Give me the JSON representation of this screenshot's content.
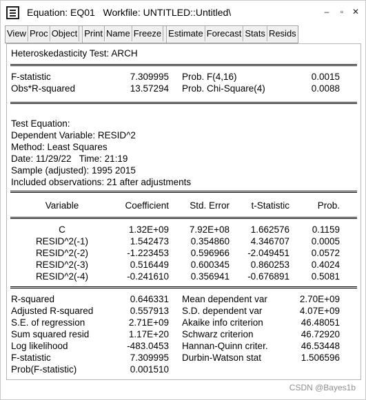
{
  "window": {
    "title": "Equation: EQ01   Workfile: UNTITLED::Untitled\\",
    "controls": [
      "‒",
      "▫",
      "✕"
    ]
  },
  "toolbar": [
    "View",
    "Proc",
    "Object",
    "Print",
    "Name",
    "Freeze",
    "Estimate",
    "Forecast",
    "Stats",
    "Resids"
  ],
  "output": {
    "test_title": "Heteroskedasticity Test: ARCH",
    "summary": [
      {
        "label": "F-statistic",
        "value": "7.309995",
        "prob_label": "Prob. F(4,16)",
        "prob": "0.0015"
      },
      {
        "label": "Obs*R-squared",
        "value": "13.57294",
        "prob_label": "Prob. Chi-Square(4)",
        "prob": "0.0088"
      }
    ],
    "header": [
      "Test Equation:",
      "Dependent Variable: RESID^2",
      "Method: Least Squares",
      "Date: 11/29/22   Time: 21:19",
      "Sample (adjusted): 1995 2015",
      "Included observations: 21 after adjustments"
    ],
    "columns": [
      "Variable",
      "Coefficient",
      "Std. Error",
      "t-Statistic",
      "Prob."
    ],
    "rows": [
      {
        "variable": "C",
        "coef": "1.32E+09",
        "se": "7.92E+08",
        "t": "1.662576",
        "p": "0.1159"
      },
      {
        "variable": "RESID^2(-1)",
        "coef": "1.542473",
        "se": "0.354860",
        "t": "4.346707",
        "p": "0.0005"
      },
      {
        "variable": "RESID^2(-2)",
        "coef": "-1.223453",
        "se": "0.596966",
        "t": "-2.049451",
        "p": "0.0572"
      },
      {
        "variable": "RESID^2(-3)",
        "coef": "0.516449",
        "se": "0.600345",
        "t": "0.860253",
        "p": "0.4024"
      },
      {
        "variable": "RESID^2(-4)",
        "coef": "-0.241610",
        "se": "0.356941",
        "t": "-0.676891",
        "p": "0.5081"
      }
    ],
    "stats_left": [
      {
        "label": "R-squared",
        "value": "0.646331"
      },
      {
        "label": "Adjusted R-squared",
        "value": "0.557913"
      },
      {
        "label": "S.E. of regression",
        "value": "2.71E+09"
      },
      {
        "label": "Sum squared resid",
        "value": "1.17E+20"
      },
      {
        "label": "Log likelihood",
        "value": "-483.0453"
      },
      {
        "label": "F-statistic",
        "value": "7.309995"
      },
      {
        "label": "Prob(F-statistic)",
        "value": "0.001510"
      }
    ],
    "stats_right": [
      {
        "label": "Mean dependent var",
        "value": "2.70E+09"
      },
      {
        "label": "S.D. dependent var",
        "value": "4.07E+09"
      },
      {
        "label": "Akaike info criterion",
        "value": "46.48051"
      },
      {
        "label": "Schwarz criterion",
        "value": "46.72920"
      },
      {
        "label": "Hannan-Quinn criter.",
        "value": "46.53448"
      },
      {
        "label": "Durbin-Watson stat",
        "value": "1.506596"
      }
    ]
  },
  "watermark": "CSDN @Bayes1b"
}
